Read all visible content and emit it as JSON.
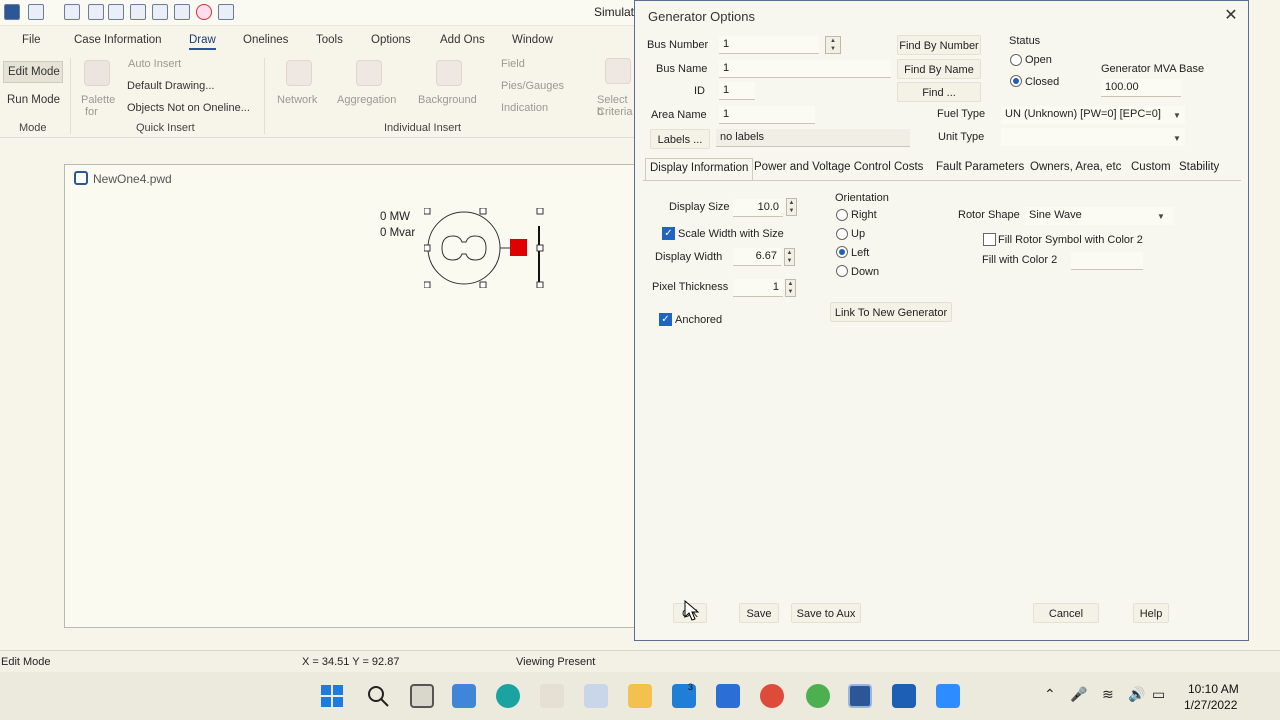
{
  "app": {
    "title": "Simulat",
    "menu": [
      "File",
      "Case Information",
      "Draw",
      "Onelines",
      "Tools",
      "Options",
      "Add Ons",
      "Window"
    ],
    "active_menu": "Draw"
  },
  "ribbon": {
    "mode": {
      "edit": "Edit Mode",
      "run": "Run Mode",
      "group": "Mode"
    },
    "palette": {
      "line1": "Palette",
      "line2": "for"
    },
    "quick_insert": {
      "auto_insert": "Auto Insert",
      "default_drawing": "Default Drawing...",
      "objects_not": "Objects Not on Oneline...",
      "group": "Quick Insert"
    },
    "individual": {
      "network": "Network",
      "aggregation": "Aggregation",
      "background": "Background",
      "field": "Field",
      "pies": "Pies/Gauges",
      "indication": "Indication",
      "select1": "Select b",
      "select2": "Criteria",
      "group": "Individual Insert"
    }
  },
  "canvas": {
    "title": "NewOne4.pwd",
    "mw": "0 MW",
    "mvar": "0 Mvar"
  },
  "statusbar": {
    "mode": "Edit Mode",
    "coords": "X = 34.51 Y = 92.87",
    "viewing": "Viewing Present"
  },
  "dialog": {
    "title": "Generator Options",
    "bus_number": {
      "label": "Bus Number",
      "value": "1"
    },
    "bus_name": {
      "label": "Bus Name",
      "value": "1"
    },
    "id": {
      "label": "ID",
      "value": "1"
    },
    "area_name": {
      "label": "Area Name",
      "value": "1"
    },
    "labels": {
      "button": "Labels ...",
      "value": "no labels"
    },
    "find_by_number": "Find By Number",
    "find_by_name": "Find By Name",
    "find": "Find ...",
    "status": {
      "label": "Status",
      "open": "Open",
      "closed": "Closed",
      "selected": "Closed"
    },
    "mva_base": {
      "label": "Generator MVA Base",
      "value": "100.00"
    },
    "fuel_type": {
      "label": "Fuel Type",
      "value": "UN (Unknown) [PW=0] [EPC=0]"
    },
    "unit_type": {
      "label": "Unit Type",
      "value": ""
    },
    "tabs": [
      "Display Information",
      "Power and Voltage Control",
      "Costs",
      "Fault Parameters",
      "Owners, Area, etc",
      "Custom",
      "Stability"
    ],
    "active_tab": "Display Information",
    "display": {
      "display_size": {
        "label": "Display Size",
        "value": "10.0"
      },
      "scale_width": {
        "label": "Scale Width with Size",
        "checked": true
      },
      "display_width": {
        "label": "Display Width",
        "value": "6.67"
      },
      "pixel_thickness": {
        "label": "Pixel Thickness",
        "value": "1"
      },
      "anchored": {
        "label": "Anchored",
        "checked": true
      },
      "orientation": {
        "label": "Orientation",
        "options": [
          "Right",
          "Up",
          "Left",
          "Down"
        ],
        "selected": "Left"
      },
      "link_new": "Link To New Generator",
      "rotor_shape": {
        "label": "Rotor Shape",
        "value": "Sine Wave"
      },
      "fill_rotor": {
        "label": "Fill Rotor Symbol with Color 2",
        "checked": false
      },
      "fill_color2": {
        "label": "Fill with Color 2"
      }
    },
    "buttons": {
      "ok": "OK",
      "save": "Save",
      "save_aux": "Save to Aux",
      "cancel": "Cancel",
      "help": "Help"
    }
  },
  "taskbar": {
    "time": "10:10 AM",
    "date": "1/27/2022",
    "badge": "3"
  },
  "colors": {
    "accent": "#2b5797",
    "selected_radio": "#1f5fb8",
    "checkbox": "#1f64c0",
    "generator_terminal": "#e00000"
  }
}
